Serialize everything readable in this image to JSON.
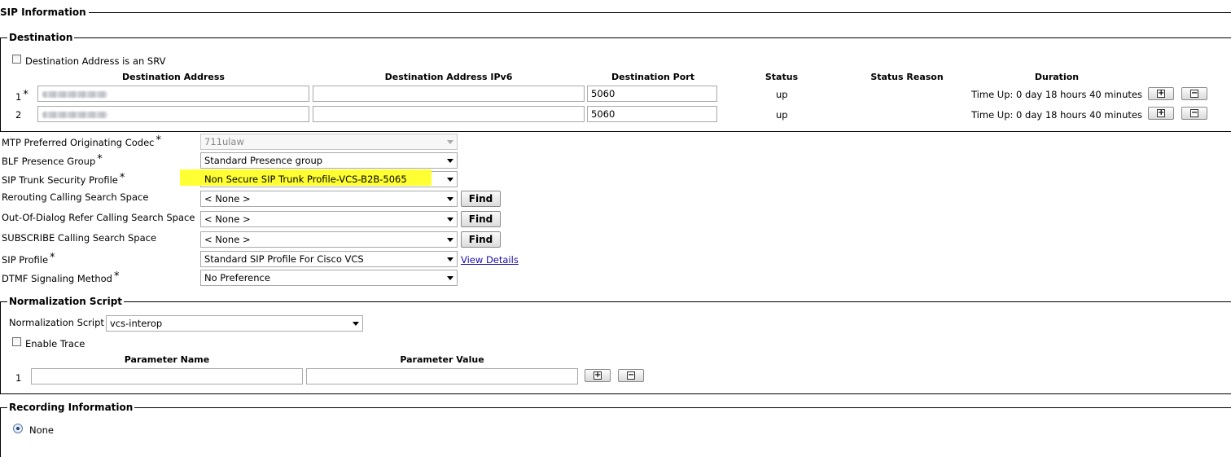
{
  "sip_information": {
    "legend": "SIP Information",
    "destination": {
      "legend": "Destination",
      "srv_checkbox_label": "Destination Address is an SRV",
      "srv_checked": false,
      "columns": {
        "address": "Destination Address",
        "ipv6": "Destination Address IPv6",
        "port": "Destination Port",
        "status": "Status",
        "status_reason": "Status Reason",
        "duration": "Duration"
      },
      "rows": [
        {
          "index": "1",
          "required": "*",
          "address": "",
          "ipv6": "",
          "port": "5060",
          "status": "up",
          "status_reason": "",
          "duration": "Time Up: 0 day 18 hours 40 minutes"
        },
        {
          "index": "2",
          "required": "",
          "address": "",
          "ipv6": "",
          "port": "5060",
          "status": "up",
          "status_reason": "",
          "duration": "Time Up: 0 day 18 hours 40 minutes"
        }
      ]
    },
    "fields": {
      "mtp_codec": {
        "label": "MTP Preferred Originating Codec",
        "required": "*",
        "value": "711ulaw"
      },
      "blf_presence": {
        "label": "BLF Presence Group",
        "required": "*",
        "value": "Standard Presence group"
      },
      "security_profile": {
        "label": "SIP Trunk Security Profile",
        "required": "*",
        "value": "Non Secure SIP Trunk Profile-VCS-B2B-5065",
        "highlight_color": "#ffff33"
      },
      "rerouting_css": {
        "label": "Rerouting Calling Search Space",
        "value": "< None >",
        "button": "Find"
      },
      "ood_refer_css": {
        "label": "Out-Of-Dialog Refer Calling Search Space",
        "value": "< None >",
        "button": "Find"
      },
      "subscribe_css": {
        "label": "SUBSCRIBE Calling Search Space",
        "value": "< None >",
        "button": "Find"
      },
      "sip_profile": {
        "label": "SIP Profile",
        "required": "*",
        "value": "Standard SIP Profile For Cisco VCS",
        "link": "View Details"
      },
      "dtmf": {
        "label": "DTMF Signaling Method",
        "required": "*",
        "value": "No Preference"
      }
    }
  },
  "normalization": {
    "legend": "Normalization Script",
    "script_label": "Normalization Script",
    "script_value": "vcs-interop",
    "trace_label": "Enable Trace",
    "trace_checked": false,
    "columns": {
      "param_name": "Parameter Name",
      "param_value": "Parameter Value"
    },
    "rows": [
      {
        "index": "1",
        "name": "",
        "value": ""
      }
    ]
  },
  "recording": {
    "legend": "Recording Information",
    "option_none": "None",
    "selected": "None"
  },
  "icons": {
    "add": "plus-icon",
    "remove": "minus-icon",
    "dropdown": "chevron-down-icon"
  }
}
